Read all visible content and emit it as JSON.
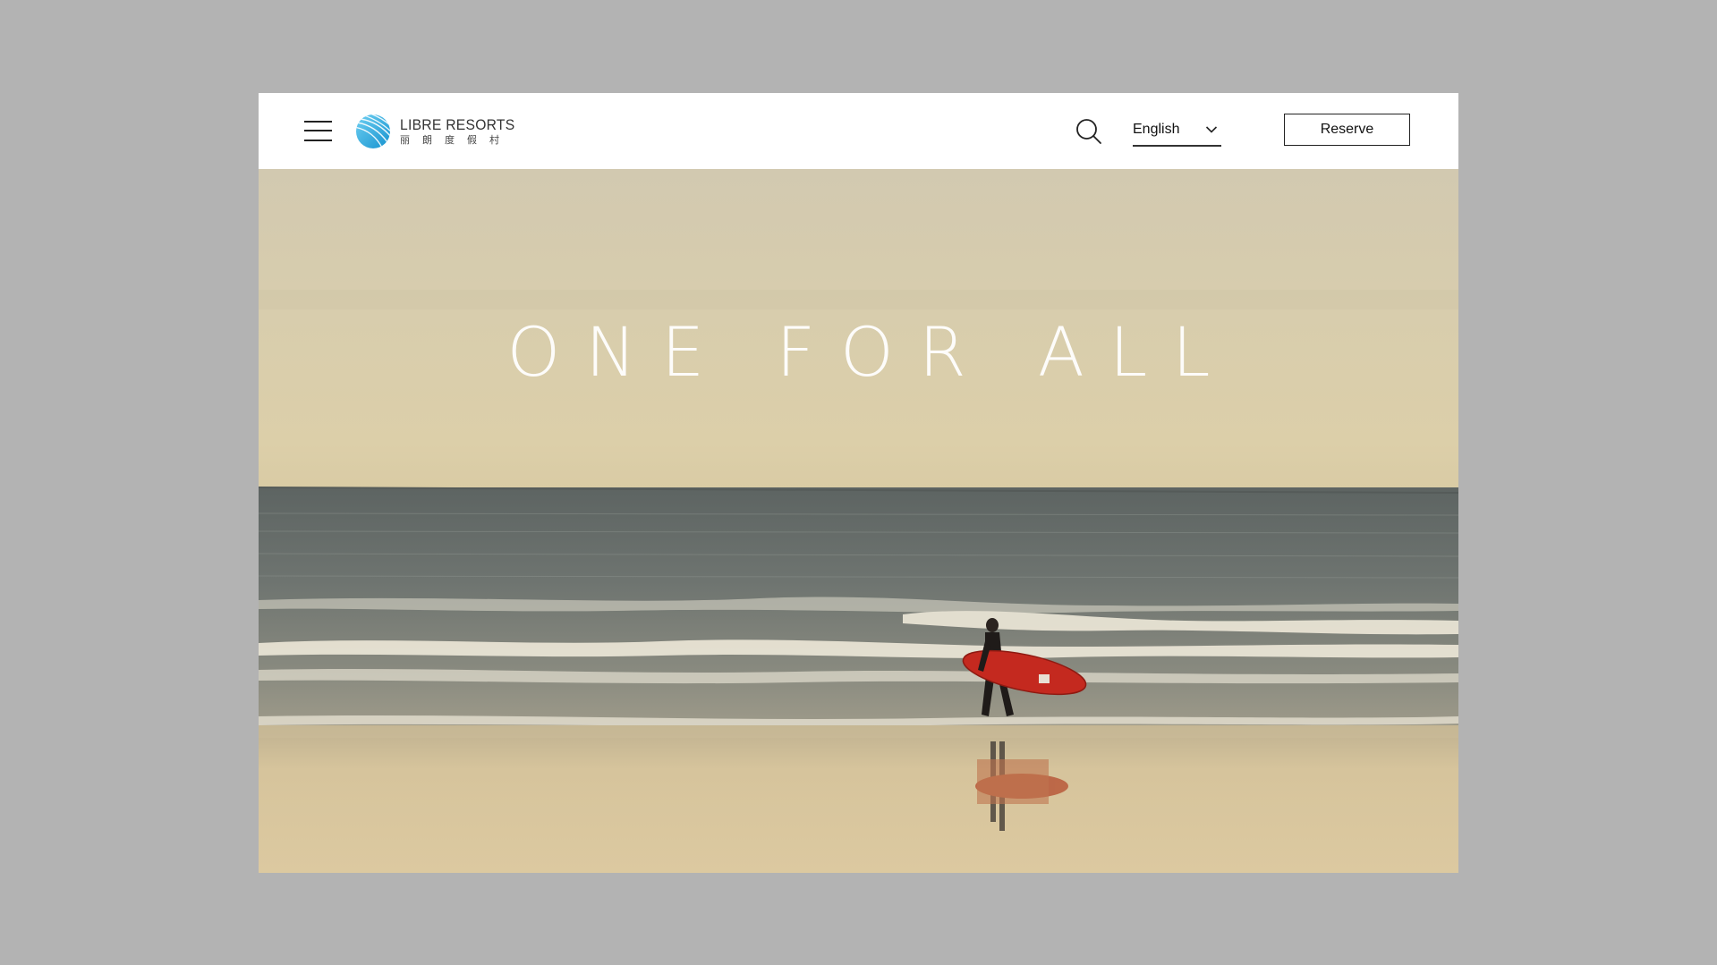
{
  "brand": {
    "name_en": "LIBRE RESORTS",
    "name_cn": "丽朗度假村",
    "logo_icon": "wave-globe-icon",
    "accent_color": "#29a9de"
  },
  "navbar": {
    "menu_icon": "hamburger-menu-icon",
    "search_icon": "search-icon",
    "language": {
      "selected": "English",
      "chevron_icon": "chevron-down-icon"
    },
    "reserve_label": "Reserve"
  },
  "hero": {
    "title": "ONE FOR ALL",
    "image": "surfer-walking-on-beach-photo"
  }
}
